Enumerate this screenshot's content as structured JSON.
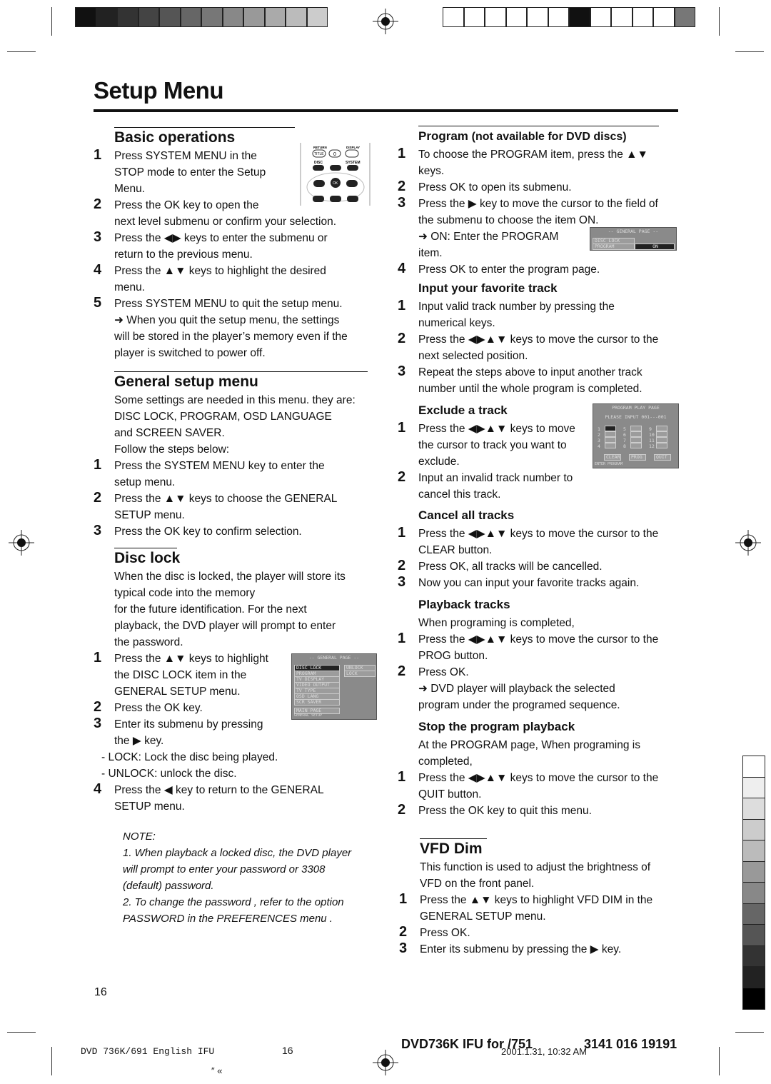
{
  "page_title": "Setup Menu",
  "page_number": "16",
  "footer": {
    "left": "DVD 736K/691 English IFU",
    "page": "16",
    "doc": "DVD736K IFU for /751",
    "timestamp": "2001.1.31, 10:32 AM",
    "code": "3141 016 19191",
    "marks": "″  «"
  },
  "colors": {
    "text": "#111111",
    "rule": "#111111",
    "screen_bg": "#8a8a8a"
  },
  "left": {
    "basic": {
      "heading": "Basic operations",
      "lines": [
        {
          "n": "1",
          "t": "Press SYSTEM MENU in the"
        },
        {
          "t": "STOP mode to enter the Setup"
        },
        {
          "t": "Menu."
        },
        {
          "n": "2",
          "t": "Press the OK key to open the"
        },
        {
          "t": "next level submenu or confirm your selection."
        },
        {
          "n": "3",
          "t": "Press the ◀▶ keys to enter the submenu or"
        },
        {
          "t": "return to the previous menu."
        },
        {
          "n": "4",
          "t": "Press the ▲▼ keys to highlight the desired"
        },
        {
          "t": "menu."
        },
        {
          "n": "5",
          "t": "Press SYSTEM MENU to quit the setup menu."
        },
        {
          "t": "➜ When you quit the setup menu, the settings"
        },
        {
          "t": "will be stored in the player’s memory even if the"
        },
        {
          "t": "player is switched to power off."
        }
      ]
    },
    "general": {
      "heading": "General setup menu",
      "lines": [
        {
          "t": "Some settings are needed in this menu. they are:"
        },
        {
          "t": "DISC LOCK, PROGRAM, OSD LANGUAGE"
        },
        {
          "t": "and SCREEN SAVER."
        },
        {
          "t": "Follow the steps below:"
        },
        {
          "n": "1",
          "t": "Press the SYSTEM MENU key to enter the"
        },
        {
          "t": "setup menu."
        },
        {
          "n": "2",
          "t": "Press the ▲▼ keys to choose the GENERAL"
        },
        {
          "t": "SETUP menu."
        },
        {
          "n": "3",
          "t": "Press the OK key to confirm selection."
        }
      ]
    },
    "disc_lock": {
      "heading": "Disc lock",
      "lines": [
        {
          "t": "When the disc is locked, the player will store its"
        },
        {
          "t": "typical code into the memory"
        },
        {
          "t": "for the future identification. For the next"
        },
        {
          "t": "playback, the DVD player will prompt to enter"
        },
        {
          "t": "the password."
        },
        {
          "n": "1",
          "t": "Press the ▲▼ keys to highlight"
        },
        {
          "t": "the DISC LOCK item in the"
        },
        {
          "t": "GENERAL SETUP menu."
        },
        {
          "n": "2",
          "t": "Press the OK key."
        },
        {
          "n": "3",
          "t": "Enter its submenu by pressing"
        },
        {
          "t": "the ▶  key."
        },
        {
          "d": true,
          "t": "- LOCK: Lock the disc being played."
        },
        {
          "d": true,
          "t": "- UNLOCK: unlock the disc."
        },
        {
          "n": "4",
          "t": "Press the ◀ key to return to the GENERAL"
        },
        {
          "t": "SETUP menu."
        }
      ]
    },
    "note": {
      "lines": [
        {
          "t": "NOTE:"
        },
        {
          "t": "1. When playback a locked disc, the DVD player"
        },
        {
          "t": "will prompt to enter your password or 3308"
        },
        {
          "t": "(default) password."
        },
        {
          "t": "2. To change the password , refer to the option"
        },
        {
          "t": "PASSWORD in the PREFERENCES menu ."
        }
      ]
    }
  },
  "right": {
    "program": {
      "heading": "Program",
      "heading_sub": "(not available for DVD discs)",
      "lines": [
        {
          "n": "1",
          "t": "To choose the PROGRAM item, press the ▲▼"
        },
        {
          "t": "keys."
        },
        {
          "n": "2",
          "t": "Press OK to open its submenu."
        },
        {
          "n": "3",
          "t": "Press the ▶ key to move the cursor to the field of"
        },
        {
          "t": "the submenu to choose the item ON."
        },
        {
          "t": " ➜ ON: Enter the PROGRAM"
        },
        {
          "t": "item."
        },
        {
          "n": "4",
          "t": "Press OK to enter the program page."
        }
      ]
    },
    "input": {
      "heading": "Input your favorite track",
      "lines": [
        {
          "n": "1",
          "t": "Input valid track number by pressing the"
        },
        {
          "t": "numerical keys."
        },
        {
          "n": "2",
          "t": "Press the ◀▶▲▼ keys to move the cursor to the"
        },
        {
          "t": "next selected position."
        },
        {
          "n": "3",
          "t": "Repeat the steps above to input another track"
        },
        {
          "t": "number until the whole program is completed."
        }
      ]
    },
    "exclude": {
      "heading": "Exclude a track",
      "lines": [
        {
          "n": "1",
          "t": "Press the ◀▶▲▼ keys to move"
        },
        {
          "t": "the cursor to track you want to"
        },
        {
          "t": "exclude."
        },
        {
          "n": "2",
          "t": "Input an invalid track number to"
        },
        {
          "t": "cancel this track."
        }
      ]
    },
    "cancel": {
      "heading": "Cancel all tracks",
      "lines": [
        {
          "n": "1",
          "t": "Press the ◀▶▲▼ keys to move the cursor to the"
        },
        {
          "t": "CLEAR button."
        },
        {
          "n": "2",
          "t": "Press OK, all tracks will be cancelled."
        },
        {
          "n": "3",
          "t": "Now you can input your favorite tracks again."
        }
      ]
    },
    "playback": {
      "heading": "Playback tracks",
      "lines": [
        {
          "t": "When programing is completed,"
        },
        {
          "n": "1",
          "t": "Press the ◀▶▲▼ keys to move the cursor to the"
        },
        {
          "t": "PROG button."
        },
        {
          "n": "2",
          "t": "Press OK."
        },
        {
          "t": "➜ DVD player will playback the selected"
        },
        {
          "t": "program under the programed sequence."
        }
      ]
    },
    "stop": {
      "heading": "Stop the program playback",
      "lines": [
        {
          "t": "At the PROGRAM page, When programing is"
        },
        {
          "t": "completed,"
        },
        {
          "n": "1",
          "t": "Press the ◀▶▲▼ keys to move the cursor to the"
        },
        {
          "t": "QUIT button."
        },
        {
          "n": "2",
          "t": "Press the OK key to quit this menu."
        }
      ]
    },
    "vfd": {
      "heading": "VFD Dim",
      "lines": [
        {
          "t": "This function is used to adjust the brightness of"
        },
        {
          "t": "VFD on the front panel."
        },
        {
          "n": "1",
          "t": "Press the ▲▼ keys to highlight  VFD DIM in the"
        },
        {
          "t": "GENERAL SETUP menu."
        },
        {
          "n": "2",
          "t": "Press OK."
        },
        {
          "n": "3",
          "t": "Enter its submenu by pressing the ▶  key."
        }
      ]
    }
  },
  "screens": {
    "disc_lock_menu": {
      "title": "-- GENERAL PAGE --",
      "items": [
        "DISC LOCK",
        "PROGRAM",
        "TV DISPLAY",
        "VIDEO OUTPUT",
        "TV TYPE",
        "OSD LANG",
        "SCR SAVER"
      ],
      "options": [
        "UNLOCK",
        "LOCK"
      ],
      "main": "MAIN PAGE",
      "status": "GENERAL SETUP"
    },
    "program_on": {
      "title": "-- GENERAL PAGE --",
      "items": [
        "DISC LOCK",
        "PROGRAM"
      ],
      "value": "ON"
    },
    "program_play": {
      "title": "PROGRAM PLAY PAGE",
      "prompt": "PLEASE INPUT 001---001",
      "slots": [
        "1",
        "2",
        "3",
        "4",
        "5",
        "6",
        "7",
        "8",
        "9",
        "10",
        "11",
        "12"
      ],
      "buttons": [
        "CLEAR",
        "PROG",
        "QUIT"
      ],
      "status": "ENTER PROGRAM"
    },
    "remote": {
      "labels": [
        "RETURN",
        "TITLE",
        "0",
        "DISPLAY",
        "DISC",
        "MENU",
        "SYSTEM",
        "MENU",
        "OK"
      ]
    }
  }
}
